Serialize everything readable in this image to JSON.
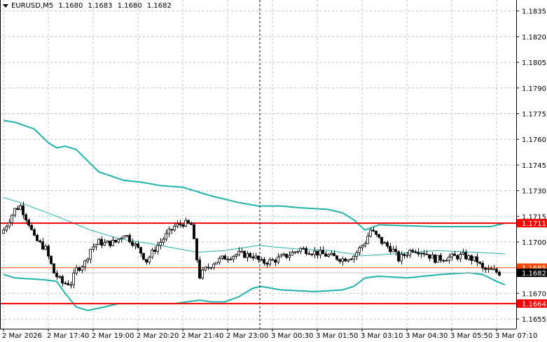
{
  "header": {
    "symbol": "EURUSD,M5",
    "open": "1.1680",
    "high": "1.1683",
    "low": "1.1680",
    "close": "1.1682"
  },
  "price_axis": {
    "ticks": [
      "1.1835",
      "1.1820",
      "1.1805",
      "1.1790",
      "1.1775",
      "1.1760",
      "1.1745",
      "1.1730",
      "1.1715",
      "1.1700",
      "1.1670",
      "1.1655"
    ],
    "tick_values": [
      1.1835,
      1.182,
      1.1805,
      1.179,
      1.1775,
      1.176,
      1.1745,
      1.173,
      1.1715,
      1.17,
      1.167,
      1.1655
    ]
  },
  "time_axis": {
    "labels": [
      "2 Mar 2026",
      "2 Mar 17:40",
      "2 Mar 19:00",
      "2 Mar 20:20",
      "2 Mar 21:40",
      "2 Mar 23:00",
      "3 Mar 00:30",
      "3 Mar 01:50",
      "3 Mar 03:10",
      "3 Mar 04:30",
      "3 Mar 05:50",
      "3 Mar 07:10"
    ],
    "label_candle_index": [
      0,
      16,
      32,
      48,
      64,
      80,
      96,
      112,
      128,
      144,
      160,
      176
    ]
  },
  "levels": [
    {
      "label": "1.1711",
      "value": 1.1711,
      "color": "#ff0000",
      "kind": "resistance"
    },
    {
      "label": "1.1685",
      "value": 1.1685,
      "color": "#ff4500",
      "kind": "level"
    },
    {
      "label": "1.1664",
      "value": 1.1664,
      "color": "#ff0000",
      "kind": "support"
    }
  ],
  "current_price": {
    "label": "1.1682",
    "value": 1.1682,
    "color": "#c0c0c0"
  },
  "crosshair_candle_index": 91.5,
  "colors": {
    "bands": "#20b2aa",
    "candle_up": "#ffffff",
    "candle_down": "#000000",
    "grid": "#c0c0c0"
  },
  "chart_data": {
    "type": "candlestick",
    "title": "EURUSD,M5",
    "candle_count": 178,
    "close_path": [
      [
        0,
        1.1707
      ],
      [
        4,
        1.1719
      ],
      [
        6,
        1.1721
      ],
      [
        9,
        1.1711
      ],
      [
        11,
        1.1702
      ],
      [
        15,
        1.1696
      ],
      [
        18,
        1.1682
      ],
      [
        21,
        1.1676
      ],
      [
        24,
        1.1676
      ],
      [
        26,
        1.1684
      ],
      [
        29,
        1.1688
      ],
      [
        31,
        1.1696
      ],
      [
        34,
        1.17
      ],
      [
        36,
        1.1699
      ],
      [
        40,
        1.17
      ],
      [
        43,
        1.1705
      ],
      [
        46,
        1.17
      ],
      [
        49,
        1.1694
      ],
      [
        51,
        1.1689
      ],
      [
        54,
        1.1696
      ],
      [
        57,
        1.1702
      ],
      [
        61,
        1.1709
      ],
      [
        64,
        1.1711
      ],
      [
        67,
        1.171
      ],
      [
        69,
        1.169
      ],
      [
        70,
        1.168
      ],
      [
        72,
        1.1684
      ],
      [
        75,
        1.1688
      ],
      [
        79,
        1.1691
      ],
      [
        84,
        1.1693
      ],
      [
        89,
        1.1692
      ],
      [
        92,
        1.1688
      ],
      [
        96,
        1.1689
      ],
      [
        101,
        1.1692
      ],
      [
        106,
        1.1696
      ],
      [
        111,
        1.1694
      ],
      [
        116,
        1.1692
      ],
      [
        121,
        1.169
      ],
      [
        125,
        1.1692
      ],
      [
        129,
        1.17
      ],
      [
        131,
        1.1707
      ],
      [
        135,
        1.17
      ],
      [
        139,
        1.1695
      ],
      [
        141,
        1.169
      ],
      [
        146,
        1.1696
      ],
      [
        150,
        1.1694
      ],
      [
        154,
        1.169
      ],
      [
        159,
        1.1691
      ],
      [
        164,
        1.1692
      ],
      [
        169,
        1.1689
      ],
      [
        171,
        1.1684
      ],
      [
        175,
        1.1683
      ],
      [
        177,
        1.1682
      ]
    ],
    "bollinger_middle": [
      [
        0,
        1.1726
      ],
      [
        6,
        1.1723
      ],
      [
        19,
        1.1715
      ],
      [
        31,
        1.1707
      ],
      [
        41,
        1.1702
      ],
      [
        56,
        1.1698
      ],
      [
        69,
        1.1694
      ],
      [
        79,
        1.1695
      ],
      [
        91,
        1.1698
      ],
      [
        104,
        1.1696
      ],
      [
        116,
        1.1695
      ],
      [
        129,
        1.1692
      ],
      [
        139,
        1.1693
      ],
      [
        154,
        1.1695
      ],
      [
        169,
        1.1694
      ],
      [
        179,
        1.1693
      ]
    ],
    "bollinger_upper": [
      [
        0,
        1.1771
      ],
      [
        4,
        1.177
      ],
      [
        11,
        1.1766
      ],
      [
        16,
        1.1758
      ],
      [
        19,
        1.1755
      ],
      [
        22,
        1.1756
      ],
      [
        26,
        1.1754
      ],
      [
        34,
        1.1741
      ],
      [
        43,
        1.1736
      ],
      [
        49,
        1.1735
      ],
      [
        56,
        1.1733
      ],
      [
        64,
        1.1732
      ],
      [
        74,
        1.1727
      ],
      [
        84,
        1.1723
      ],
      [
        91,
        1.1721
      ],
      [
        99,
        1.1721
      ],
      [
        106,
        1.172
      ],
      [
        116,
        1.1719
      ],
      [
        121,
        1.1717
      ],
      [
        125,
        1.1713
      ],
      [
        129,
        1.1707
      ],
      [
        134,
        1.171
      ],
      [
        154,
        1.1709
      ],
      [
        174,
        1.1709
      ],
      [
        179,
        1.1711
      ]
    ],
    "bollinger_lower": [
      [
        0,
        1.1681
      ],
      [
        4,
        1.1679
      ],
      [
        14,
        1.1678
      ],
      [
        19,
        1.1677
      ],
      [
        22,
        1.167
      ],
      [
        26,
        1.1662
      ],
      [
        30,
        1.166
      ],
      [
        36,
        1.1662
      ],
      [
        41,
        1.1664
      ],
      [
        51,
        1.1664
      ],
      [
        61,
        1.1664
      ],
      [
        70,
        1.1666
      ],
      [
        74,
        1.1665
      ],
      [
        79,
        1.1665
      ],
      [
        84,
        1.1668
      ],
      [
        89,
        1.1673
      ],
      [
        92,
        1.1674
      ],
      [
        99,
        1.1672
      ],
      [
        111,
        1.1671
      ],
      [
        121,
        1.1672
      ],
      [
        125,
        1.1674
      ],
      [
        129,
        1.1679
      ],
      [
        134,
        1.168
      ],
      [
        144,
        1.1679
      ],
      [
        156,
        1.1681
      ],
      [
        166,
        1.1682
      ],
      [
        171,
        1.1681
      ],
      [
        176,
        1.1677
      ],
      [
        179,
        1.1675
      ]
    ],
    "ylim": [
      1.165,
      1.184
    ]
  }
}
